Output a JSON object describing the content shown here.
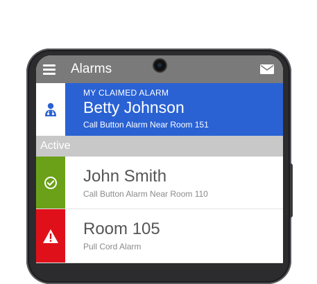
{
  "appbar": {
    "title": "Alarms",
    "menu_icon": "hamburger-menu-icon",
    "mail_icon": "envelope-icon"
  },
  "claimed": {
    "kicker": "MY CLAIMED ALARM",
    "name": "Betty Johnson",
    "description": "Call Button Alarm Near Room 151",
    "icon": "staff-person-icon",
    "color": "#2a62d4"
  },
  "section": {
    "label": "Active"
  },
  "alarms": [
    {
      "name": "John Smith",
      "description": "Call Button Alarm Near Room 110",
      "icon": "check-circle-icon",
      "color": "#6aa118"
    },
    {
      "name": "Room 105",
      "description": "Pull Cord Alarm",
      "icon": "warning-triangle-icon",
      "color": "#e0101a"
    }
  ]
}
